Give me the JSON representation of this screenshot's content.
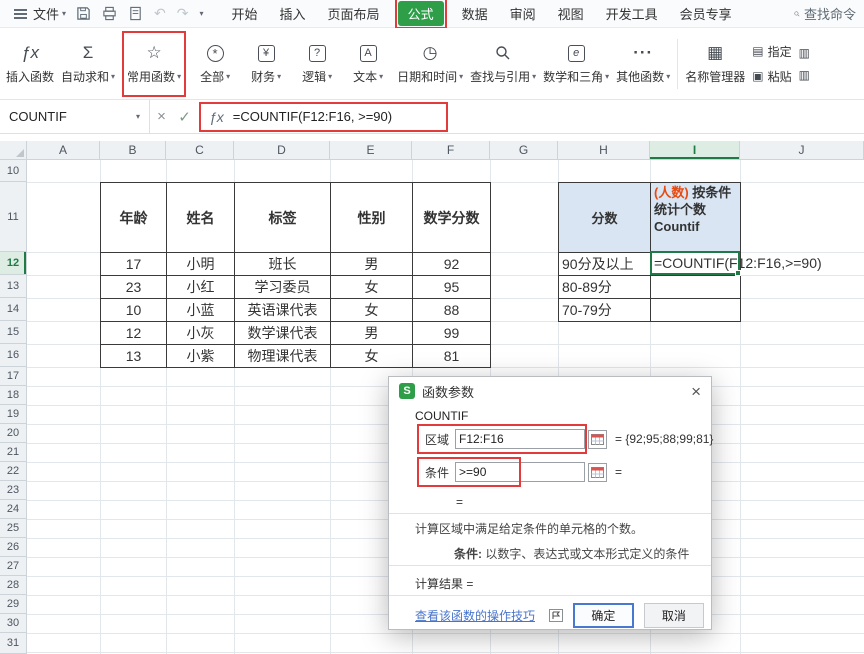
{
  "colors": {
    "wps_green": "#2f9e49",
    "annotation_red": "#e23b3b",
    "selection_green": "#1f7a46",
    "table_header_blue": "#d9e5f3",
    "count_orange": "#e8490f",
    "link_blue": "#4874cb"
  },
  "menubar": {
    "file": "文件",
    "tabs": [
      "开始",
      "插入",
      "页面布局",
      "公式",
      "数据",
      "审阅",
      "视图",
      "开发工具",
      "会员专享"
    ],
    "active_tab": "公式",
    "search": "查找命令"
  },
  "ribbon": {
    "insert_function": "插入函数",
    "autosum": "自动求和",
    "common_functions": "常用函数",
    "all": "全部",
    "financial": "财务",
    "logical": "逻辑",
    "text": "文本",
    "date_time": "日期和时间",
    "lookup_reference": "查找与引用",
    "math_trig": "数学和三角",
    "other_functions": "其他函数",
    "name_manager": "名称管理器",
    "assign": "指定",
    "paste": "粘贴"
  },
  "formula_bar": {
    "name_box": "COUNTIF",
    "formula": "=COUNTIF(F12:F16, >=90)"
  },
  "grid": {
    "columns": [
      "A",
      "B",
      "C",
      "D",
      "E",
      "F",
      "G",
      "H",
      "I",
      "J"
    ],
    "rows": [
      "10",
      "11",
      "12",
      "13",
      "14",
      "15",
      "16",
      "17",
      "18",
      "19",
      "20",
      "21",
      "22",
      "23",
      "24",
      "25",
      "26",
      "27",
      "28",
      "29",
      "30",
      "31"
    ]
  },
  "table1": {
    "headers": [
      "年龄",
      "姓名",
      "标签",
      "性别",
      "数学分数"
    ],
    "rows": [
      [
        "17",
        "小明",
        "班长",
        "男",
        "92"
      ],
      [
        "23",
        "小红",
        "学习委员",
        "女",
        "95"
      ],
      [
        "10",
        "小蓝",
        "英语课代表",
        "女",
        "88"
      ],
      [
        "12",
        "小灰",
        "数学课代表",
        "男",
        "99"
      ],
      [
        "13",
        "小紫",
        "物理课代表",
        "女",
        "81"
      ]
    ]
  },
  "table2": {
    "score_header": "分数",
    "count_header_orange": "(人数)",
    "count_header_text": "按条件统计个数 Countif",
    "row_labels": [
      "90分及以上",
      "80-89分",
      "70-79分"
    ],
    "active_formula": "=COUNTIF(F12:F16,>=90)"
  },
  "dialog": {
    "title": "函数参数",
    "function_name": "COUNTIF",
    "range_label": "区域",
    "range_value": "F12:F16",
    "range_result": "= {92;95;88;99;81}",
    "criteria_label": "条件",
    "criteria_value": ">=90",
    "criteria_result": "=",
    "equals": "=",
    "description": "计算区域中满足给定条件的单元格的个数。",
    "hint_label": "条件:",
    "hint_text": " 以数字、表达式或文本形式定义的条件",
    "result_label": "计算结果 =",
    "help_link": "查看该函数的操作技巧",
    "ok": "确定",
    "cancel": "取消"
  }
}
